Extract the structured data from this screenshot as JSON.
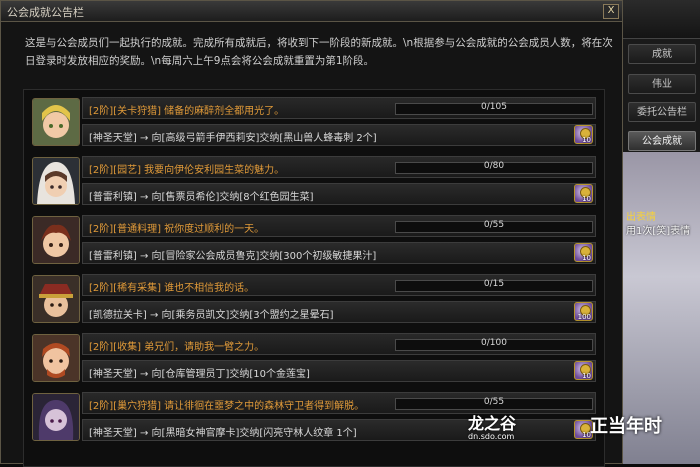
{
  "window": {
    "title": "公会成就公告栏",
    "close_label": "X",
    "intro": "这是与公会成员们一起执行的成就。完成所有成就后，将收到下一阶段的新成就。\\n根据参与公会成就的公会成员人数，将在次日登录时发放相应的奖励。\\n每周六上午9点会将公会成就重置为第1阶段。"
  },
  "quests": [
    {
      "title": "[2阶][关卡狩猎] 储备的麻醉剂全都用光了。",
      "progress": "0/105",
      "fraction": 0,
      "task": "[神圣天堂] → 向[高级弓箭手伊西莉安]交纳[黑山兽人蜂毒刺 2个]",
      "reward_count": "10",
      "avatar": "elf-blonde-avatar"
    },
    {
      "title": "[2阶][园艺] 我要向伊伦安利园生菜的魅力。",
      "progress": "0/80",
      "fraction": 0,
      "task": "[普雷利镇] → 向[售票员希伦]交纳[8个红色园生菜]",
      "reward_count": "10",
      "avatar": "hooded-girl-avatar"
    },
    {
      "title": "[2阶][普通料理] 祝你度过顺利的一天。",
      "progress": "0/55",
      "fraction": 0,
      "task": "[普雷利镇] → 向[冒险家公会成员鲁克]交纳[300个初级敏捷果汁]",
      "reward_count": "10",
      "avatar": "boy-avatar"
    },
    {
      "title": "[2阶][稀有采集] 谁也不相信我的话。",
      "progress": "0/15",
      "fraction": 0,
      "task": "[凯德拉关卡] → 向[乘务员凯文]交纳[3个盟约之星晕石]",
      "reward_count": "100",
      "avatar": "hat-man-avatar"
    },
    {
      "title": "[2阶][收集] 弟兄们，请助我一臂之力。",
      "progress": "0/100",
      "fraction": 0,
      "task": "[神圣天堂] → 向[仓库管理员丁]交纳[10个金莲宝]",
      "reward_count": "10",
      "avatar": "dwarf-avatar"
    },
    {
      "title": "[2阶][巢穴狩猎] 请让徘徊在噩梦之中的森林守卫者得到解脱。",
      "progress": "0/55",
      "fraction": 0,
      "task": "[神圣天堂] → 向[黑暗女神官摩卡]交纳[闪亮守林人纹章 1个]",
      "reward_count": "10",
      "avatar": "dark-priestess-avatar"
    }
  ],
  "side": {
    "tabs": [
      "成就",
      "伟业",
      "委托公告栏",
      "公会成就"
    ],
    "active_tab": "公会成就",
    "chat_line1": "出表情",
    "chat_line2": "用1次[笑]表情"
  },
  "watermark": {
    "logo_cn": "龙之谷",
    "url": "dn.sdo.com",
    "slogan": "正当年时"
  },
  "colors": {
    "quest_title": "#e09a39",
    "panel_bg": "#141414",
    "frame": "#5b5546"
  }
}
